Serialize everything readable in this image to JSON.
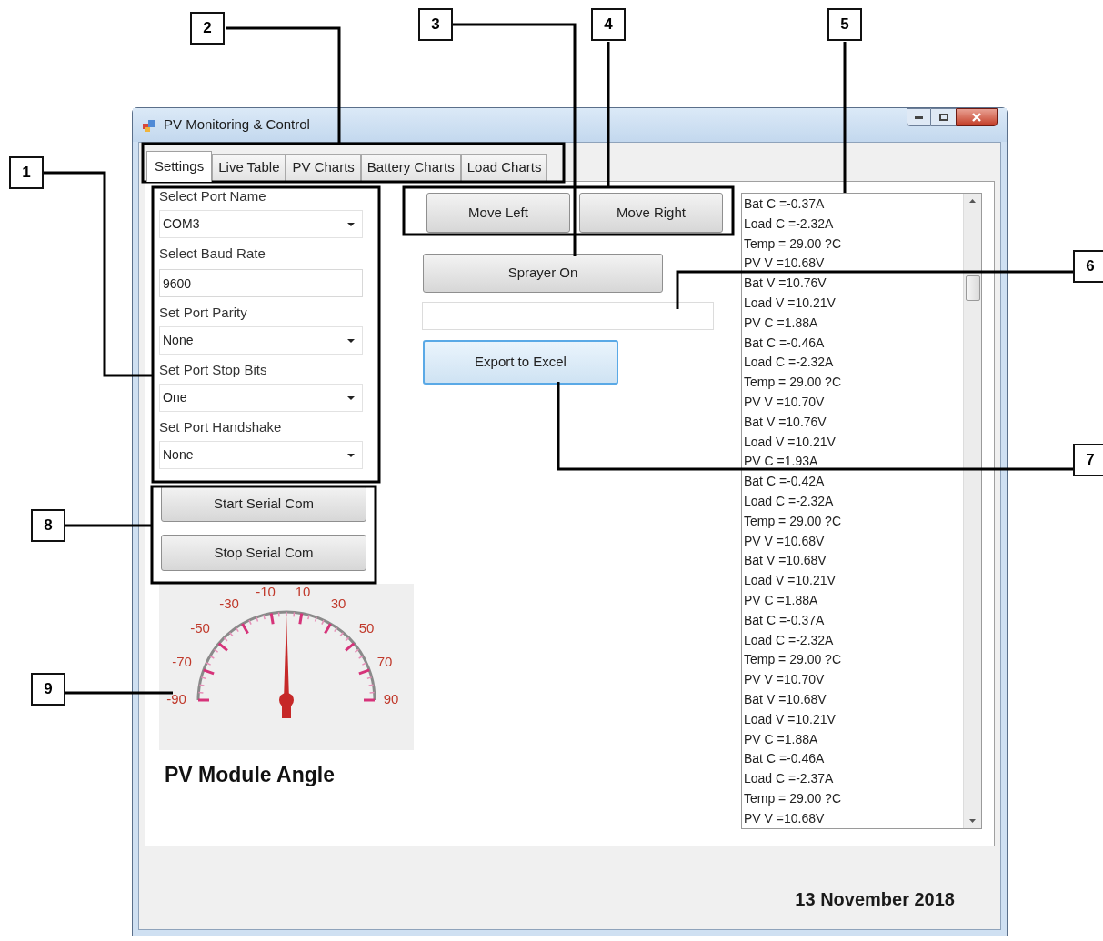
{
  "window": {
    "title": "PV Monitoring & Control"
  },
  "tabs": [
    {
      "label": "Settings",
      "selected": true
    },
    {
      "label": "Live Table",
      "selected": false
    },
    {
      "label": "PV Charts",
      "selected": false
    },
    {
      "label": "Battery Charts",
      "selected": false
    },
    {
      "label": "Load Charts",
      "selected": false
    }
  ],
  "settings": [
    {
      "label": "Select Port Name",
      "kind": "dropdown",
      "value": "COM3"
    },
    {
      "label": "Select Baud Rate",
      "kind": "text",
      "value": "9600"
    },
    {
      "label": "Set Port Parity",
      "kind": "dropdown",
      "value": "None"
    },
    {
      "label": "Set Port Stop Bits",
      "kind": "dropdown",
      "value": "One"
    },
    {
      "label": "Set Port Handshake",
      "kind": "dropdown",
      "value": "None"
    }
  ],
  "serial_buttons": [
    "Start Serial Com",
    "Stop Serial Com"
  ],
  "gauge": {
    "labels": [
      "-90",
      "-70",
      "-50",
      "-30",
      "-10",
      "10",
      "30",
      "50",
      "70",
      "90"
    ],
    "title": "PV Module Angle"
  },
  "move_buttons": [
    "Move Left",
    "Move Right"
  ],
  "sprayer_button": "Sprayer On",
  "export_button": "Export to Excel",
  "log": [
    "Bat C =-0.37A",
    "Load C =-2.32A",
    "Temp = 29.00 ?C",
    "PV V =10.68V",
    "Bat V =10.76V",
    "Load V =10.21V",
    "PV C =1.88A",
    "Bat C =-0.46A",
    "Load C =-2.32A",
    "Temp = 29.00 ?C",
    "PV V =10.70V",
    "Bat V =10.76V",
    "Load V =10.21V",
    "PV C =1.93A",
    "Bat C =-0.42A",
    "Load C =-2.32A",
    "Temp = 29.00 ?C",
    "PV V =10.68V",
    "Bat V =10.68V",
    "Load V =10.21V",
    "PV C =1.88A",
    "Bat C =-0.37A",
    "Load C =-2.32A",
    "Temp = 29.00 ?C",
    "PV V =10.70V",
    "Bat V =10.68V",
    "Load V =10.21V",
    "PV C =1.88A",
    "Bat C =-0.46A",
    "Load C =-2.37A",
    "Temp = 29.00 ?C",
    "PV V =10.68V"
  ],
  "date": "13 November 2018",
  "callouts": [
    "1",
    "2",
    "3",
    "4",
    "5",
    "6",
    "7",
    "8",
    "9"
  ]
}
